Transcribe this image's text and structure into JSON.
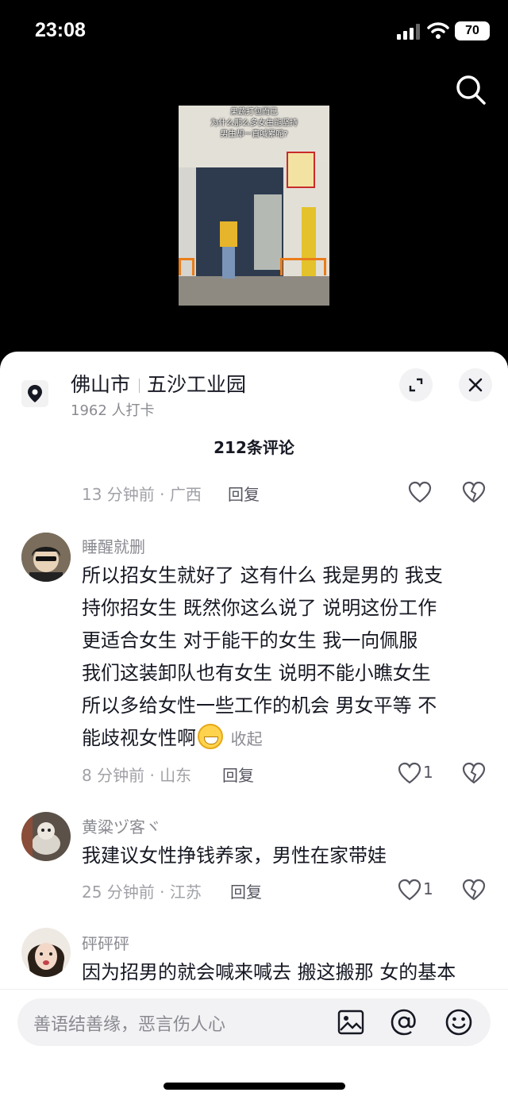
{
  "status_bar": {
    "time": "23:08",
    "battery": "70"
  },
  "video": {
    "caption_lines": [
      "果蔬打包而已",
      "为什么那么多女生能坚持",
      "男生却一直喊累呢?"
    ]
  },
  "location": {
    "city": "佛山市",
    "place": "五沙工业园",
    "checkins": "1962 人打卡"
  },
  "comments_count": "212条评论",
  "comments": [
    {
      "time_location": "13 分钟前 · 广西",
      "reply_label": "回复",
      "likes": ""
    },
    {
      "nickname": "睡醒就删",
      "lines": [
        "所以招女生就好了  这有什么  我是男的  我支",
        "持你招女生  既然你这么说了    说明这份工作",
        "更适合女生         对于能干的女生  我一向佩服",
        "我们这装卸队也有女生   说明不能小瞧女生",
        "所以多给女性一些工作的机会  男女平等  不",
        "能歧视女性啊"
      ],
      "collapse_label": "收起",
      "time_location": "8 分钟前 · 山东",
      "reply_label": "回复",
      "likes": "1"
    },
    {
      "nickname": "黄粱ヅ客ヾ",
      "lines": [
        "我建议女性挣钱养家，男性在家带娃"
      ],
      "time_location": "25 分钟前 · 江苏",
      "reply_label": "回复",
      "likes": "1"
    },
    {
      "nickname": "砰砰砰",
      "lines": [
        "因为招男的就会喊来喊去 搬这搬那 女的基本"
      ]
    }
  ],
  "input": {
    "placeholder": "善语结善缘，恶言伤人心"
  },
  "colors": {
    "sheet_bg": "#ffffff",
    "page_bg": "#000000",
    "text_primary": "#161823",
    "text_secondary": "#8a8b91"
  }
}
